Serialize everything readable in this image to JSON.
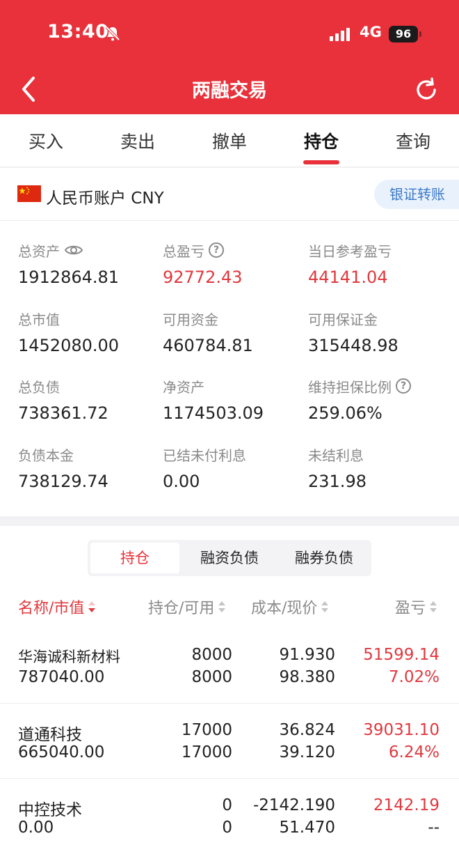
{
  "status": {
    "time": "13:40",
    "network": "4G",
    "battery": "96"
  },
  "header": {
    "title": "两融交易"
  },
  "tabs": [
    {
      "label": "买入",
      "active": false
    },
    {
      "label": "卖出",
      "active": false
    },
    {
      "label": "撤单",
      "active": false
    },
    {
      "label": "持仓",
      "active": true
    },
    {
      "label": "查询",
      "active": false
    }
  ],
  "account": {
    "name": "人民币账户 CNY",
    "transfer_label": "银证转账"
  },
  "summary": [
    {
      "label": "总资产",
      "value": "1912864.81",
      "icon": "eye-icon",
      "color": "normal"
    },
    {
      "label": "总盈亏",
      "value": "92772.43",
      "icon": "question-icon",
      "color": "red"
    },
    {
      "label": "当日参考盈亏",
      "value": "44141.04",
      "icon": "",
      "color": "red"
    },
    {
      "label": "总市值",
      "value": "1452080.00",
      "icon": "",
      "color": "normal"
    },
    {
      "label": "可用资金",
      "value": "460784.81",
      "icon": "",
      "color": "normal"
    },
    {
      "label": "可用保证金",
      "value": "315448.98",
      "icon": "",
      "color": "normal"
    },
    {
      "label": "总负债",
      "value": "738361.72",
      "icon": "",
      "color": "normal"
    },
    {
      "label": "净资产",
      "value": "1174503.09",
      "icon": "",
      "color": "normal"
    },
    {
      "label": "维持担保比例",
      "value": "259.06%",
      "icon": "question-icon",
      "color": "normal"
    },
    {
      "label": "负债本金",
      "value": "738129.74",
      "icon": "",
      "color": "normal"
    },
    {
      "label": "已结未付利息",
      "value": "0.00",
      "icon": "",
      "color": "normal"
    },
    {
      "label": "未结利息",
      "value": "231.98",
      "icon": "",
      "color": "normal"
    }
  ],
  "segments": [
    {
      "label": "持仓",
      "active": true
    },
    {
      "label": "融资负债",
      "active": false
    },
    {
      "label": "融券负债",
      "active": false
    }
  ],
  "columns": [
    "名称/市值",
    "持仓/可用",
    "成本/现价",
    "盈亏"
  ],
  "positions": [
    {
      "name": "华海诚科新材料",
      "market_value": "787040.00",
      "holding": "8000",
      "available": "8000",
      "cost": "91.930",
      "price": "98.380",
      "pnl": "51599.14",
      "pnl_pct": "7.02%"
    },
    {
      "name": "道通科技",
      "market_value": "665040.00",
      "holding": "17000",
      "available": "17000",
      "cost": "36.824",
      "price": "39.120",
      "pnl": "39031.10",
      "pnl_pct": "6.24%"
    },
    {
      "name": "中控技术",
      "market_value": "0.00",
      "holding": "0",
      "available": "0",
      "cost": "-2142.190",
      "price": "51.470",
      "pnl": "2142.19",
      "pnl_pct": "--"
    }
  ],
  "colors": {
    "brand_red": "#e8313a",
    "profit_red": "#e0383e",
    "link_blue": "#3b78c6"
  }
}
